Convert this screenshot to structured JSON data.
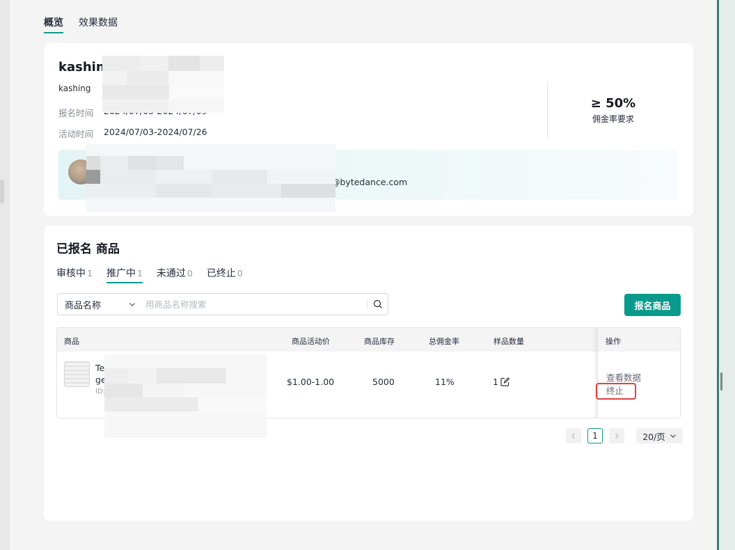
{
  "top_tabs": [
    {
      "label": "概览",
      "active": true
    },
    {
      "label": "效果数据",
      "active": false
    }
  ],
  "campaign": {
    "title": "kashing",
    "subtitle": "kashing",
    "signup_time_label": "报名时间",
    "signup_time_value": "2024/07/03-2024/07/09",
    "active_time_label": "活动时间",
    "active_time_value": "2024/07/03-2024/07/26",
    "commission_value": "≥ 50%",
    "commission_label": "佣金率要求",
    "contact_email": "@bytedance.com"
  },
  "registered": {
    "title": "已报名 商品",
    "tabs": [
      {
        "label": "审核中",
        "count": "1",
        "active": false
      },
      {
        "label": "推广中",
        "count": "1",
        "active": true
      },
      {
        "label": "未通过",
        "count": "0",
        "active": false
      },
      {
        "label": "已终止",
        "count": "0",
        "active": false
      }
    ],
    "search": {
      "select_value": "商品名称",
      "placeholder": "用商品名称搜索"
    },
    "register_button": "报名商品",
    "table": {
      "headers": {
        "product": "商品",
        "price": "商品活动价",
        "stock": "商品库存",
        "commission": "总佣金率",
        "samples": "样品数量",
        "actions": "操作"
      },
      "rows": [
        {
          "name_line1": "Te",
          "name_line2": "ge",
          "id_label": "ID:",
          "price": "$1.00-1.00",
          "stock": "5000",
          "commission": "11%",
          "samples": "1",
          "action_view": "查看数据",
          "action_terminate": "终止"
        }
      ]
    },
    "pagination": {
      "current_page": "1",
      "page_size": "20/页"
    }
  },
  "colors": {
    "accent": "#0a9a8c",
    "highlight_box": "#e0403a"
  }
}
